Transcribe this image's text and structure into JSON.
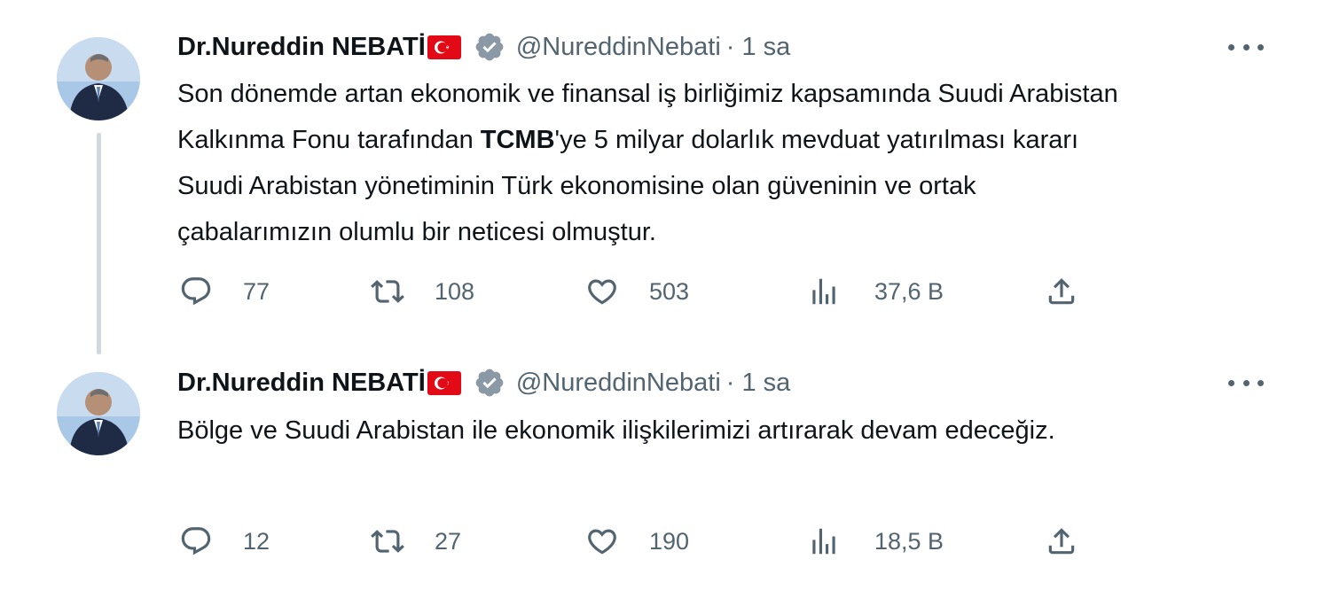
{
  "colors": {
    "text": "#0f1419",
    "secondary": "#536471",
    "thread_line": "#cfd9de",
    "verified": "#8b98a5",
    "flag_red": "#e30a17"
  },
  "tweets": [
    {
      "display_name": "Dr.Nureddin NEBATİ",
      "flag": "turkey-flag",
      "verified": true,
      "handle": "@NureddinNebati",
      "separator": "·",
      "time": "1 sa",
      "text_parts": {
        "a": "Son dönemde artan ekonomik ve finansal iş birliğimiz kapsamında Suudi Arabistan Kalkınma Fonu tarafından ",
        "b": "TCMB",
        "c": "'ye 5 milyar dolarlık mevduat yatırılması kararı Suudi Arabistan yönetiminin Türk ekonomisine olan güveninin ve ortak çabalarımızın olumlu bir neticesi olmuştur."
      },
      "stats": {
        "replies": "77",
        "retweets": "108",
        "likes": "503",
        "views": "37,6 B"
      }
    },
    {
      "display_name": "Dr.Nureddin NEBATİ",
      "flag": "turkey-flag",
      "verified": true,
      "handle": "@NureddinNebati",
      "separator": "·",
      "time": "1 sa",
      "text_parts": {
        "a": "Bölge ve Suudi Arabistan ile ekonomik ilişkilerimizi artırarak devam edeceğiz."
      },
      "stats": {
        "replies": "12",
        "retweets": "27",
        "likes": "190",
        "views": "18,5 B"
      }
    }
  ],
  "icons": {
    "reply": "reply-icon",
    "retweet": "retweet-icon",
    "like": "heart-icon",
    "views": "views-chart-icon",
    "share": "share-icon",
    "more": "more-dots-icon",
    "verified": "verified-badge-icon"
  }
}
